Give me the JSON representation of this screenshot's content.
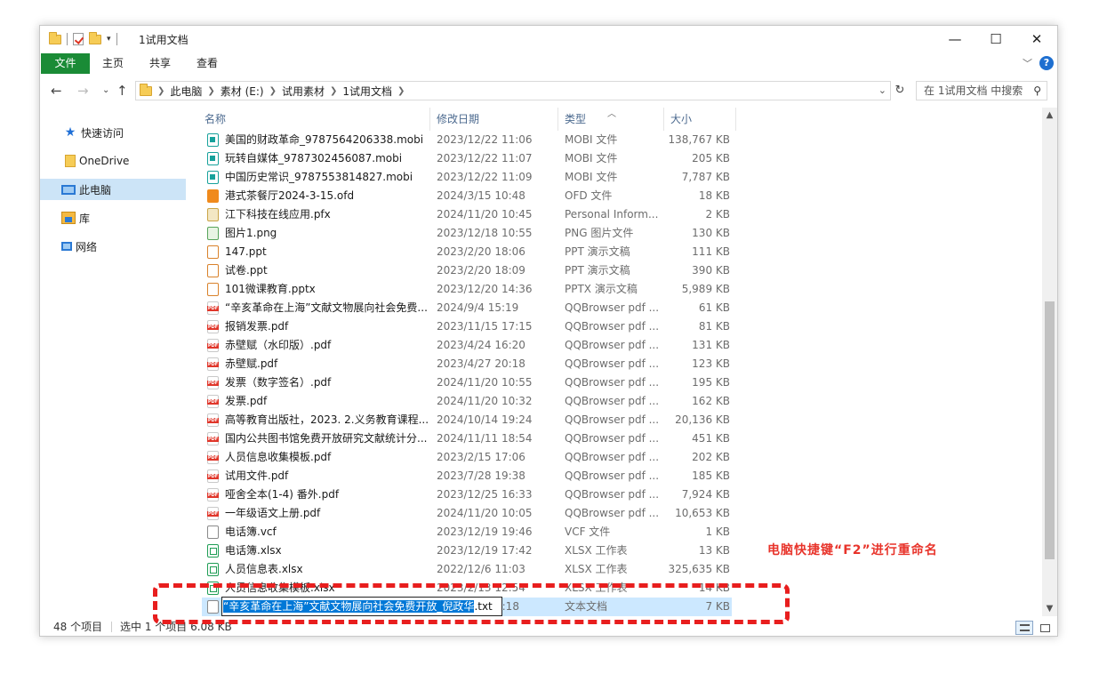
{
  "window": {
    "title": "1试用文档",
    "minimize": "—",
    "maximize": "☐",
    "close": "✕"
  },
  "ribbon": {
    "tabs": [
      "文件",
      "主页",
      "共享",
      "查看"
    ],
    "help": "?"
  },
  "address": {
    "crumbs": [
      "此电脑",
      "素材 (E:)",
      "试用素材",
      "1试用文档"
    ],
    "search_placeholder": "在 1试用文档 中搜索"
  },
  "sidebar": {
    "items": [
      "快速访问",
      "OneDrive",
      "此电脑",
      "库",
      "网络"
    ]
  },
  "columns": {
    "name": "名称",
    "date": "修改日期",
    "type": "类型",
    "size": "大小"
  },
  "files": [
    {
      "name": "美国的财政革命_9787564206338.mobi",
      "date": "2023/12/22 11:06",
      "type": "MOBI 文件",
      "size": "138,767 KB",
      "icon": "mobi"
    },
    {
      "name": "玩转自媒体_9787302456087.mobi",
      "date": "2023/12/22 11:07",
      "type": "MOBI 文件",
      "size": "205 KB",
      "icon": "mobi"
    },
    {
      "name": "中国历史常识_9787553814827.mobi",
      "date": "2023/12/22 11:09",
      "type": "MOBI 文件",
      "size": "7,787 KB",
      "icon": "mobi"
    },
    {
      "name": "港式茶餐厅2024-3-15.ofd",
      "date": "2024/3/15 10:48",
      "type": "OFD 文件",
      "size": "18 KB",
      "icon": "ofd"
    },
    {
      "name": "江下科技在线应用.pfx",
      "date": "2024/11/20 10:45",
      "type": "Personal Inform...",
      "size": "2 KB",
      "icon": "pfx"
    },
    {
      "name": "图片1.png",
      "date": "2023/12/18 10:55",
      "type": "PNG 图片文件",
      "size": "130 KB",
      "icon": "png"
    },
    {
      "name": "147.ppt",
      "date": "2023/2/20 18:06",
      "type": "PPT 演示文稿",
      "size": "111 KB",
      "icon": "ppt"
    },
    {
      "name": "试卷.ppt",
      "date": "2023/2/20 18:09",
      "type": "PPT 演示文稿",
      "size": "390 KB",
      "icon": "ppt"
    },
    {
      "name": "101微课教育.pptx",
      "date": "2023/12/20 14:36",
      "type": "PPTX 演示文稿",
      "size": "5,989 KB",
      "icon": "ppt"
    },
    {
      "name": "“辛亥革命在上海”文献文物展向社会免费...",
      "date": "2024/9/4 15:19",
      "type": "QQBrowser pdf ...",
      "size": "61 KB",
      "icon": "pdf"
    },
    {
      "name": "报销发票.pdf",
      "date": "2023/11/15 17:15",
      "type": "QQBrowser pdf ...",
      "size": "81 KB",
      "icon": "pdf"
    },
    {
      "name": "赤壁赋（水印版）.pdf",
      "date": "2023/4/24 16:20",
      "type": "QQBrowser pdf ...",
      "size": "131 KB",
      "icon": "pdf"
    },
    {
      "name": "赤壁赋.pdf",
      "date": "2023/4/27 20:18",
      "type": "QQBrowser pdf ...",
      "size": "123 KB",
      "icon": "pdf"
    },
    {
      "name": "发票（数字签名）.pdf",
      "date": "2024/11/20 10:55",
      "type": "QQBrowser pdf ...",
      "size": "195 KB",
      "icon": "pdf"
    },
    {
      "name": "发票.pdf",
      "date": "2024/11/20 10:32",
      "type": "QQBrowser pdf ...",
      "size": "162 KB",
      "icon": "pdf"
    },
    {
      "name": "高等教育出版社，2023. 2.义务教育课程...",
      "date": "2024/10/14 19:24",
      "type": "QQBrowser pdf ...",
      "size": "20,136 KB",
      "icon": "pdf"
    },
    {
      "name": "国内公共图书馆免费开放研究文献统计分...",
      "date": "2024/11/11 18:54",
      "type": "QQBrowser pdf ...",
      "size": "451 KB",
      "icon": "pdf"
    },
    {
      "name": "人员信息收集模板.pdf",
      "date": "2023/2/15 17:06",
      "type": "QQBrowser pdf ...",
      "size": "202 KB",
      "icon": "pdf"
    },
    {
      "name": "试用文件.pdf",
      "date": "2023/7/28 19:38",
      "type": "QQBrowser pdf ...",
      "size": "185 KB",
      "icon": "pdf"
    },
    {
      "name": "哑舍全本(1-4) 番外.pdf",
      "date": "2023/12/25 16:33",
      "type": "QQBrowser pdf ...",
      "size": "7,924 KB",
      "icon": "pdf"
    },
    {
      "name": "一年级语文上册.pdf",
      "date": "2024/11/20 10:05",
      "type": "QQBrowser pdf ...",
      "size": "10,653 KB",
      "icon": "pdf"
    },
    {
      "name": "电话簿.vcf",
      "date": "2023/12/19 19:46",
      "type": "VCF 文件",
      "size": "1 KB",
      "icon": "vcf"
    },
    {
      "name": "电话簿.xlsx",
      "date": "2023/12/19 17:42",
      "type": "XLSX 工作表",
      "size": "13 KB",
      "icon": "xlsx"
    },
    {
      "name": "人员信息表.xlsx",
      "date": "2022/12/6 11:03",
      "type": "XLSX 工作表",
      "size": "325,635 KB",
      "icon": "xlsx"
    },
    {
      "name": "人员信息收集模板.xlsx",
      "date": "2023/2/13 12:54",
      "type": "XLSX 工作表",
      "size": "14 KB",
      "icon": "xlsx"
    }
  ],
  "selected_file": {
    "date_tail": "5:18",
    "type": "文本文档",
    "size": "7 KB",
    "rename_selected": "“辛亥革命在上海”文献文物展向社会免费开放_倪政华",
    "rename_ext": ".txt"
  },
  "status": {
    "count": "48 个项目",
    "selection": "选中 1 个项目  6.08 KB"
  },
  "annotation": {
    "text": "电脑快捷键“F2”进行重命名",
    "color": "#e81e1e"
  }
}
